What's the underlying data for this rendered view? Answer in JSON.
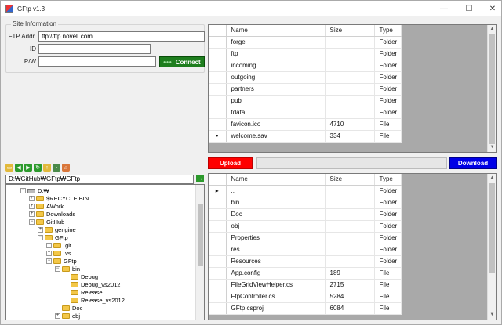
{
  "window": {
    "title": "GFtp v1.3",
    "minimize": "—",
    "maximize": "☐",
    "close": "✕"
  },
  "site": {
    "group_label": "Site Information",
    "ftp_label": "FTP Addr.",
    "ftp_value": "ftp://ftp.novell.com",
    "id_label": "ID",
    "id_value": "",
    "pw_label": "P/W",
    "pw_value": "",
    "connect_dots": "•••",
    "connect_label": "Connect"
  },
  "remote": {
    "columns": [
      "Name",
      "Size",
      "Type"
    ],
    "rows": [
      {
        "marker": "",
        "name": "forge",
        "size": "",
        "type": "Folder"
      },
      {
        "marker": "",
        "name": "ftp",
        "size": "",
        "type": "Folder"
      },
      {
        "marker": "",
        "name": "incoming",
        "size": "",
        "type": "Folder"
      },
      {
        "marker": "",
        "name": "outgoing",
        "size": "",
        "type": "Folder"
      },
      {
        "marker": "",
        "name": "partners",
        "size": "",
        "type": "Folder"
      },
      {
        "marker": "",
        "name": "pub",
        "size": "",
        "type": "Folder"
      },
      {
        "marker": "",
        "name": "tdata",
        "size": "",
        "type": "Folder"
      },
      {
        "marker": "",
        "name": "favicon.ico",
        "size": "4710",
        "type": "File"
      },
      {
        "marker": "•",
        "name": "welcome.sav",
        "size": "334",
        "type": "File"
      }
    ]
  },
  "transfer": {
    "upload_label": "Upload",
    "download_label": "Download"
  },
  "local": {
    "path": "D:₩GitHub₩GFtp₩GFtp",
    "go_icon": "→",
    "columns": [
      "Name",
      "Size",
      "Type"
    ],
    "rows": [
      {
        "marker": "▸",
        "name": "..",
        "size": "",
        "type": "Folder"
      },
      {
        "marker": "",
        "name": "bin",
        "size": "",
        "type": "Folder"
      },
      {
        "marker": "",
        "name": "Doc",
        "size": "",
        "type": "Folder"
      },
      {
        "marker": "",
        "name": "obj",
        "size": "",
        "type": "Folder"
      },
      {
        "marker": "",
        "name": "Properties",
        "size": "",
        "type": "Folder"
      },
      {
        "marker": "",
        "name": "res",
        "size": "",
        "type": "Folder"
      },
      {
        "marker": "",
        "name": "Resources",
        "size": "",
        "type": "Folder"
      },
      {
        "marker": "",
        "name": "App.config",
        "size": "189",
        "type": "File"
      },
      {
        "marker": "",
        "name": "FileGridViewHelper.cs",
        "size": "2715",
        "type": "File"
      },
      {
        "marker": "",
        "name": "FtpController.cs",
        "size": "5284",
        "type": "File"
      },
      {
        "marker": "",
        "name": "GFtp.csproj",
        "size": "6084",
        "type": "File"
      }
    ]
  },
  "tree": {
    "nodes": [
      {
        "label": "D:₩",
        "depth": 0,
        "expander": "−",
        "icon": "drive"
      },
      {
        "label": "$RECYCLE.BIN",
        "depth": 1,
        "expander": "+",
        "icon": "folder"
      },
      {
        "label": "AWork",
        "depth": 1,
        "expander": "+",
        "icon": "folder"
      },
      {
        "label": "Downloads",
        "depth": 1,
        "expander": "+",
        "icon": "folder"
      },
      {
        "label": "GitHub",
        "depth": 1,
        "expander": "−",
        "icon": "folder"
      },
      {
        "label": "gengine",
        "depth": 2,
        "expander": "+",
        "icon": "folder"
      },
      {
        "label": "GFtp",
        "depth": 2,
        "expander": "−",
        "icon": "folder"
      },
      {
        "label": ".git",
        "depth": 3,
        "expander": "+",
        "icon": "folder"
      },
      {
        "label": ".vs",
        "depth": 3,
        "expander": "+",
        "icon": "folder"
      },
      {
        "label": "GFtp",
        "depth": 3,
        "expander": "−",
        "icon": "folder"
      },
      {
        "label": "bin",
        "depth": 4,
        "expander": "−",
        "icon": "folder"
      },
      {
        "label": "Debug",
        "depth": 5,
        "expander": "",
        "icon": "folder"
      },
      {
        "label": "Debug_vs2012",
        "depth": 5,
        "expander": "",
        "icon": "folder"
      },
      {
        "label": "Release",
        "depth": 5,
        "expander": "",
        "icon": "folder"
      },
      {
        "label": "Release_vs2012",
        "depth": 5,
        "expander": "",
        "icon": "folder"
      },
      {
        "label": "Doc",
        "depth": 4,
        "expander": "",
        "icon": "folder"
      },
      {
        "label": "obj",
        "depth": 4,
        "expander": "+",
        "icon": "folder"
      }
    ]
  },
  "toolbar": {
    "icons": [
      {
        "name": "open-folder-icon",
        "glyph": "▭",
        "color": "#e2b93b"
      },
      {
        "name": "back-icon",
        "glyph": "◀",
        "color": "#2c9a2c"
      },
      {
        "name": "forward-icon",
        "glyph": "▶",
        "color": "#2c9a2c"
      },
      {
        "name": "refresh-icon",
        "glyph": "↻",
        "color": "#2c9a2c"
      },
      {
        "name": "up-folder-icon",
        "glyph": "↑",
        "color": "#e2b93b"
      },
      {
        "name": "new-file-icon",
        "glyph": "▫",
        "color": "#4a8a4a"
      },
      {
        "name": "home-icon",
        "glyph": "⌂",
        "color": "#d9763a"
      }
    ]
  }
}
